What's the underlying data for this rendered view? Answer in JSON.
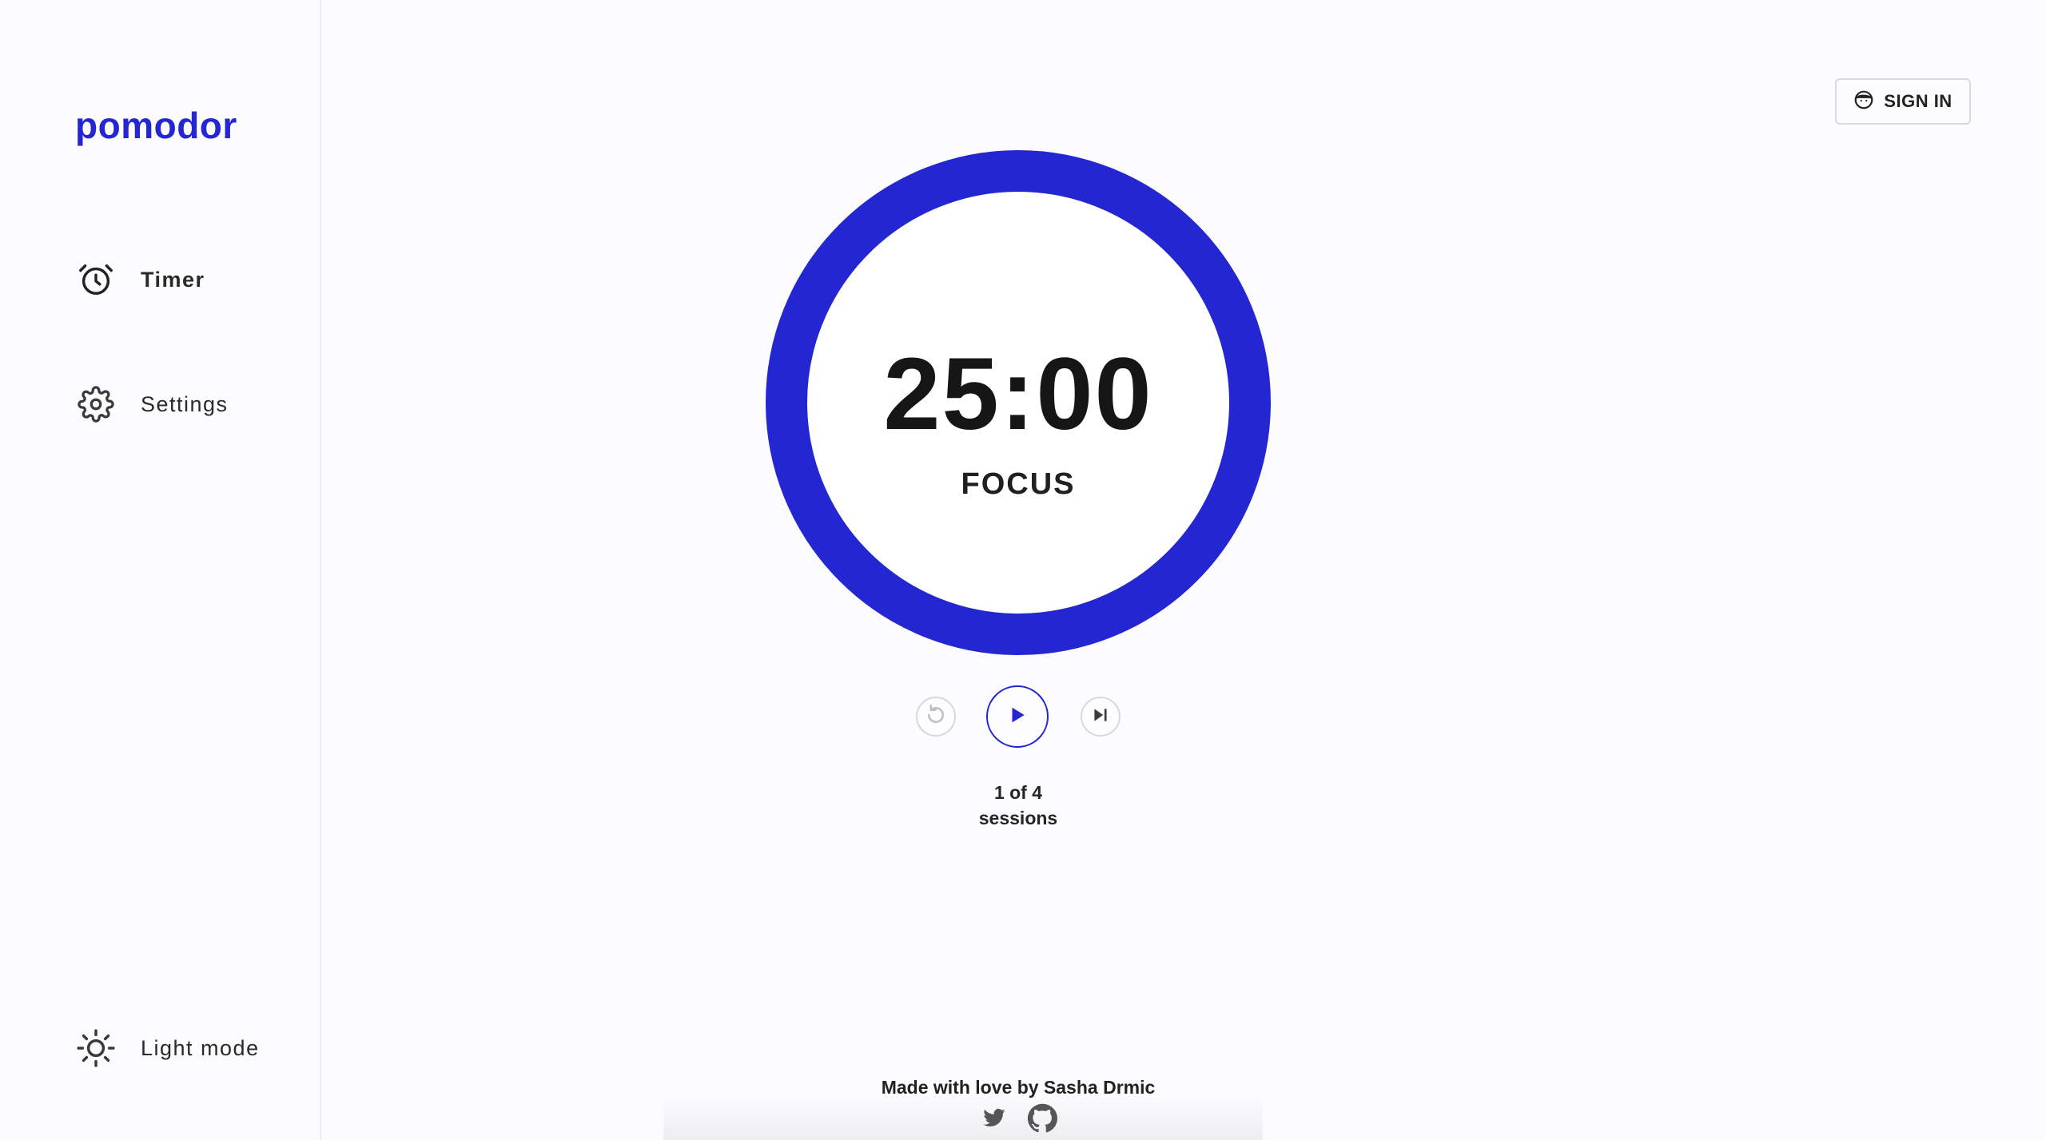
{
  "brand": {
    "logo_text": "pomodor",
    "accent_color": "#2426d2"
  },
  "sidebar": {
    "items": [
      {
        "label": "Timer",
        "icon": "alarm-clock-icon",
        "active": true
      },
      {
        "label": "Settings",
        "icon": "gear-icon",
        "active": false
      }
    ],
    "theme_toggle": {
      "label": "Light mode",
      "icon": "sun-icon"
    }
  },
  "header": {
    "signin_label": "SIGN IN",
    "signin_icon": "user-face-icon"
  },
  "timer": {
    "time": "25:00",
    "mode": "FOCUS",
    "progress_fraction": 1.0,
    "session_line1": "1 of 4",
    "session_line2": "sessions"
  },
  "controls": {
    "reset_icon": "restart-icon",
    "play_icon": "play-icon",
    "skip_icon": "skip-next-icon"
  },
  "footer": {
    "credit": "Made with love by Sasha Drmic",
    "social_icons": [
      "twitter-icon",
      "github-icon"
    ]
  }
}
